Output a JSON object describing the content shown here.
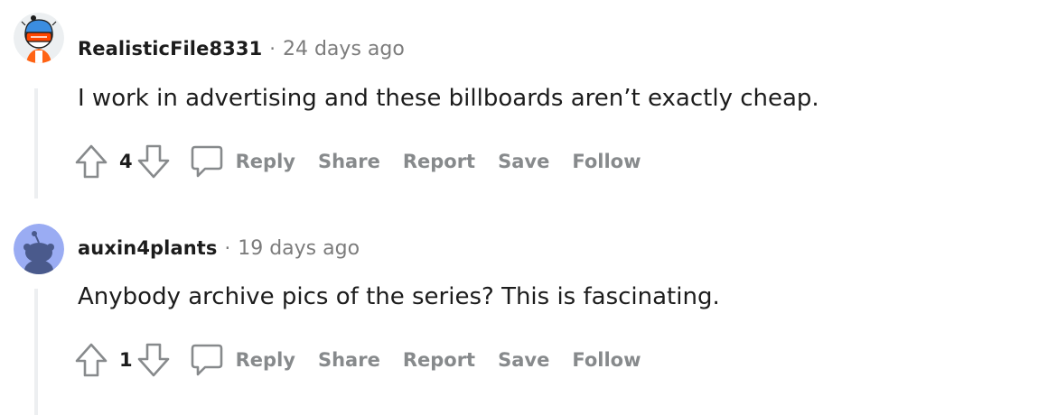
{
  "comments": [
    {
      "author": "RealisticFile8331",
      "separator": "·",
      "time": "24 days ago",
      "text": "I work in advertising and these billboards aren’t exactly cheap.",
      "score": "4",
      "actions": {
        "reply": "Reply",
        "share": "Share",
        "report": "Report",
        "save": "Save",
        "follow": "Follow"
      }
    },
    {
      "author": "auxin4plants",
      "separator": "·",
      "time": "19 days ago",
      "text": "Anybody archive pics of the series? This is fascinating.",
      "score": "1",
      "actions": {
        "reply": "Reply",
        "share": "Share",
        "report": "Report",
        "save": "Save",
        "follow": "Follow"
      }
    }
  ],
  "icons": {
    "upvote": "upvote-arrow-icon",
    "downvote": "downvote-arrow-icon",
    "reply": "speech-bubble-icon",
    "avatar_1": "snoo-avatar-with-helmet",
    "avatar_2": "default-snoo-avatar"
  },
  "colors": {
    "text": "#1c1c1c",
    "muted": "#7c7c7c",
    "action": "#878a8c",
    "thread_line": "#edeff1",
    "avatar_2_bg": "#9aacf3"
  }
}
